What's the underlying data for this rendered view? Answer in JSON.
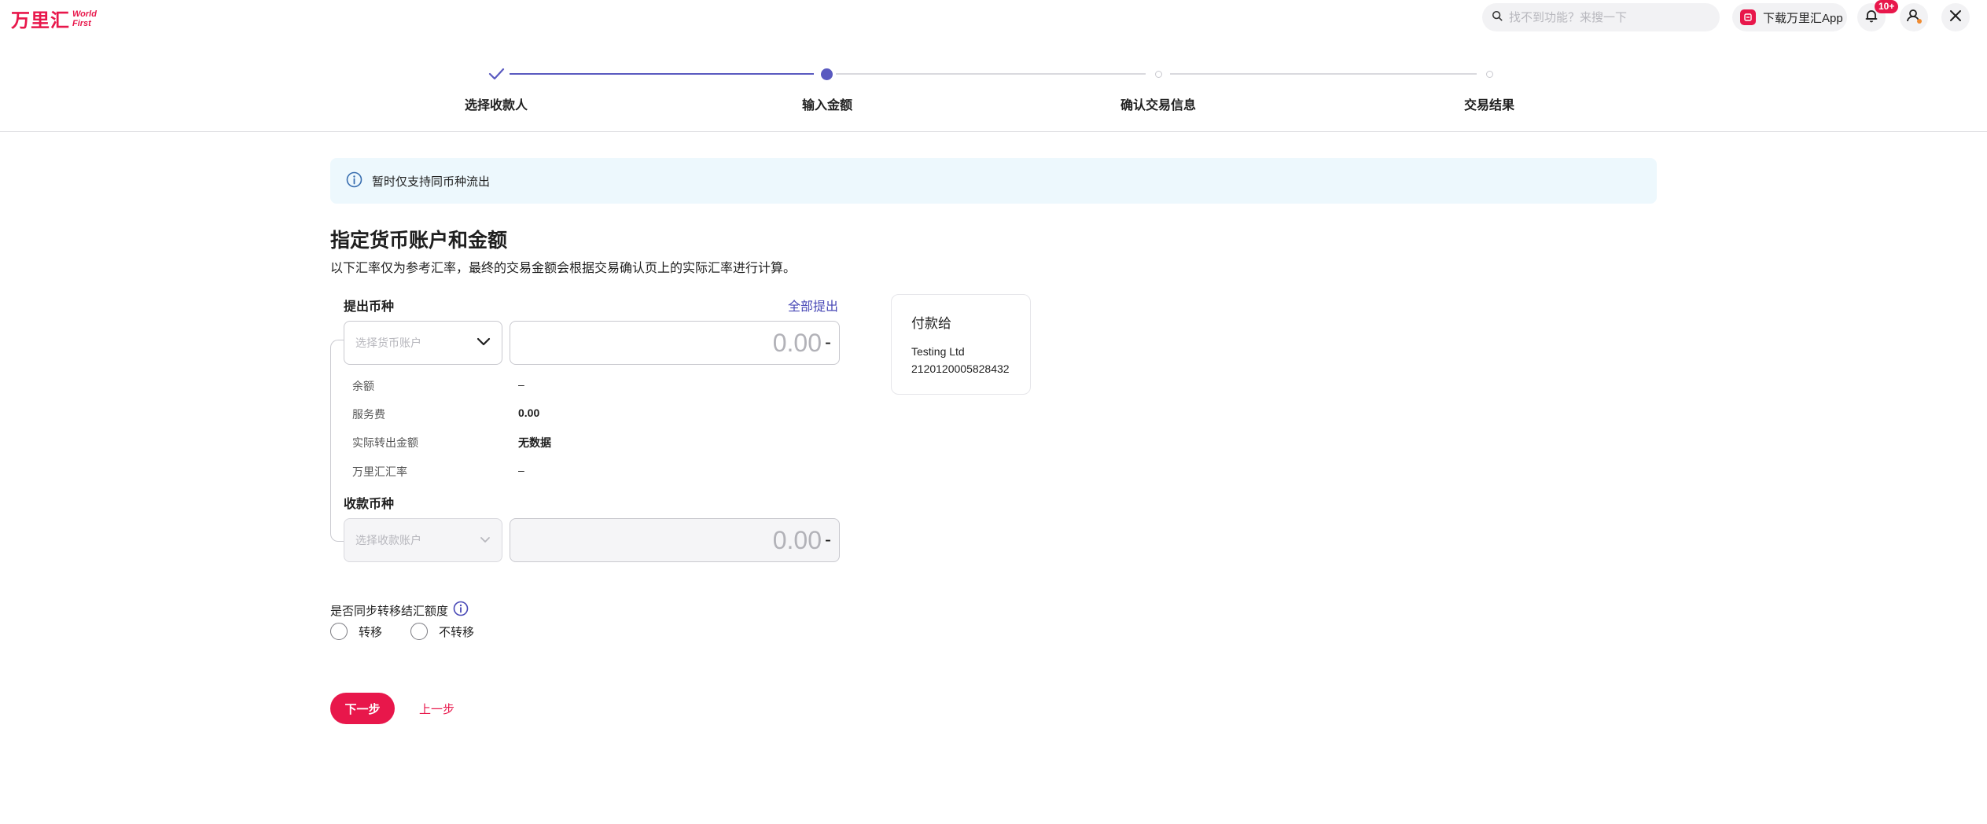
{
  "header": {
    "logo_cn": "万里汇",
    "logo_en_line1": "World",
    "logo_en_line2": "First",
    "search_placeholder": "找不到功能？来搜一下",
    "download_label": "下载万里汇App",
    "notification_badge": "10+",
    "icons": [
      "search-icon",
      "app-icon",
      "bell-icon",
      "user-icon",
      "close-icon"
    ]
  },
  "steps": [
    {
      "label": "选择收款人",
      "status": "done"
    },
    {
      "label": "输入金额",
      "status": "current"
    },
    {
      "label": "确认交易信息",
      "status": "pending"
    },
    {
      "label": "交易结果",
      "status": "pending"
    }
  ],
  "banner": {
    "text": "暂时仅支持同币种流出"
  },
  "section": {
    "title": "指定货币账户和金额",
    "desc": "以下汇率仅为参考汇率，最终的交易金额会根据交易确认页上的实际汇率进行计算。"
  },
  "withdraw": {
    "label": "提出币种",
    "withdraw_all": "全部提出",
    "select_placeholder": "选择货币账户",
    "amount": "0.00",
    "suffix": "-"
  },
  "details": [
    {
      "label": "余额",
      "value": "–",
      "bold": false
    },
    {
      "label": "服务费",
      "value": "0.00",
      "bold": true
    },
    {
      "label": "实际转出金额",
      "value": "无数据",
      "bold": true
    },
    {
      "label": "万里汇汇率",
      "value": "–",
      "bold": false
    }
  ],
  "receive": {
    "label": "收款币种",
    "select_placeholder": "选择收款账户",
    "amount": "0.00",
    "suffix": "-"
  },
  "payee": {
    "title": "付款给",
    "name": "Testing Ltd",
    "account": "2120120005828432"
  },
  "sync": {
    "label": "是否同步转移结汇额度",
    "options": [
      "转移",
      "不转移"
    ]
  },
  "actions": {
    "next": "下一步",
    "prev": "上一步"
  },
  "colors": {
    "brand": "#e8174b",
    "accent": "#5a5ac0",
    "link": "#4848b6",
    "banner_bg": "#edf8fd"
  }
}
